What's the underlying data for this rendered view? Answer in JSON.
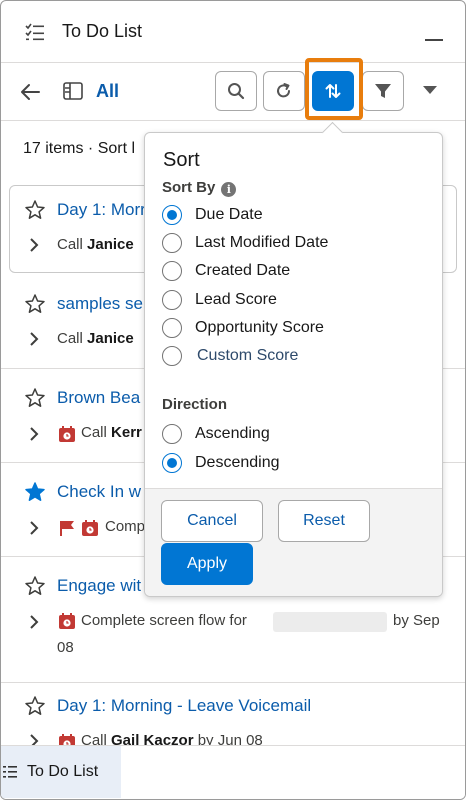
{
  "header": {
    "title": "To Do List"
  },
  "toolbar": {
    "view_label": "All"
  },
  "status": {
    "count_text": "17 items · Sort l"
  },
  "tasks": [
    {
      "subject": "Day 1: Morr",
      "detail_prefix": "Call",
      "contact": "Janice",
      "starred": false
    },
    {
      "subject": "samples se",
      "detail_prefix": "Call",
      "contact": "Janice",
      "starred": false
    },
    {
      "subject": "Brown Bea",
      "detail_prefix": "Call",
      "contact": "Kerr",
      "starred": false
    },
    {
      "subject": "Check In w",
      "detail_prefix": "Comp",
      "contact": "",
      "starred": true
    },
    {
      "subject": "Engage wit",
      "detail_prefix": "Complete screen flow for",
      "detail_suffix": "by Sep",
      "detail_line2": "08",
      "starred": false
    },
    {
      "subject": "Day 1: Morning - Leave Voicemail",
      "detail_prefix": "Call",
      "contact": "Gail Kaczor",
      "detail_suffix": "by Jun 08",
      "starred": false
    }
  ],
  "sort_popover": {
    "title": "Sort",
    "sort_by_label": "Sort By",
    "sort_options": [
      "Due Date",
      "Last Modified Date",
      "Created Date",
      "Lead Score",
      "Opportunity Score",
      "Custom Score"
    ],
    "sort_selected": "Due Date",
    "direction_label": "Direction",
    "direction_options": [
      "Ascending",
      "Descending"
    ],
    "direction_selected": "Descending",
    "cancel_label": "Cancel",
    "reset_label": "Reset",
    "apply_label": "Apply"
  },
  "utility_bar": {
    "tab_label": "To Do List"
  },
  "colors": {
    "brand": "#0176d3",
    "link": "#0b5cab",
    "highlight": "#e87d0d",
    "alert_red": "#c23934"
  },
  "icons": [
    "checklist-icon",
    "minimize-icon",
    "back-arrow-icon",
    "list-view-icon",
    "search-icon",
    "refresh-icon",
    "sort-icon",
    "filter-icon",
    "chevron-down-icon",
    "star-icon",
    "chevron-right-icon",
    "calendar-icon",
    "flag-icon",
    "info-icon"
  ]
}
